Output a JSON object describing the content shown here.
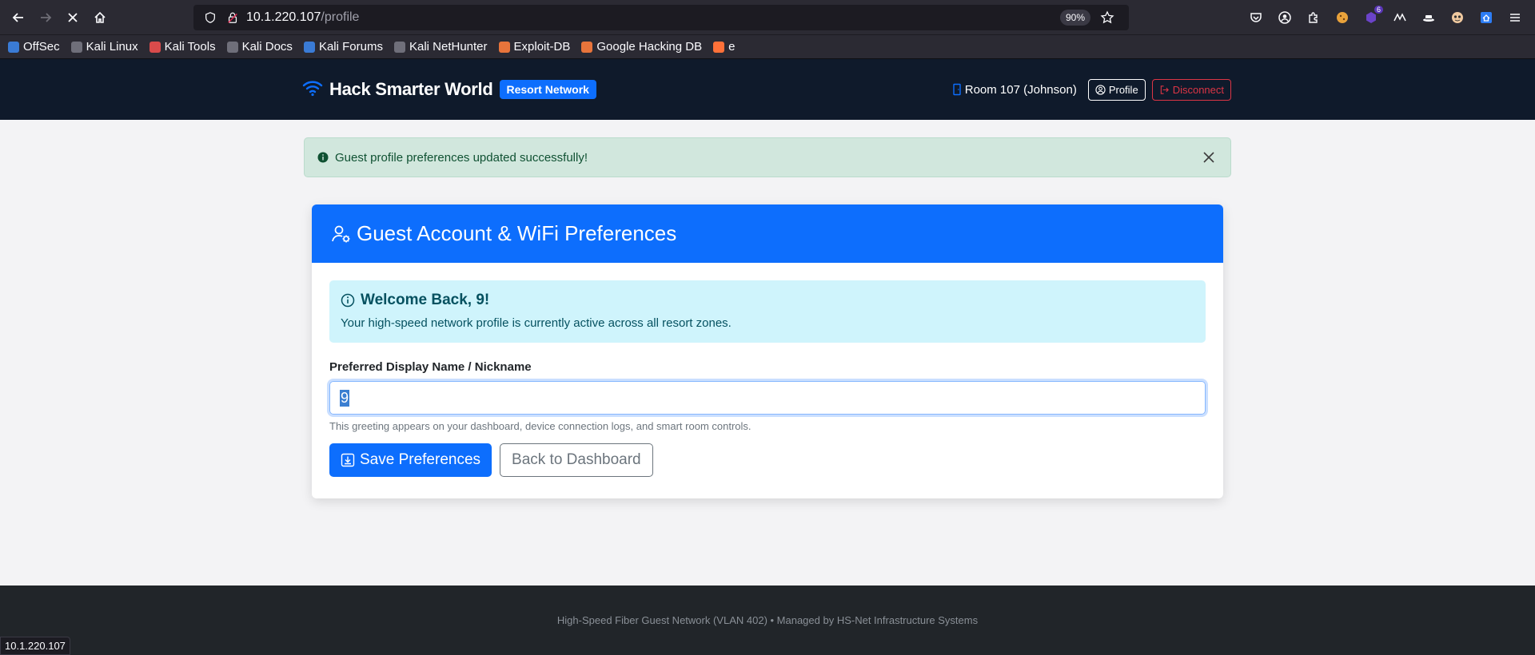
{
  "browser": {
    "url_host": "10.1.220.107",
    "url_path": "/profile",
    "zoom": "90%",
    "bookmarks": [
      {
        "label": "OffSec",
        "color": "#3a7bd5"
      },
      {
        "label": "Kali Linux",
        "color": "#6f6f7a"
      },
      {
        "label": "Kali Tools",
        "color": "#d94b4b"
      },
      {
        "label": "Kali Docs",
        "color": "#6f6f7a"
      },
      {
        "label": "Kali Forums",
        "color": "#3a7bd5"
      },
      {
        "label": "Kali NetHunter",
        "color": "#6f6f7a"
      },
      {
        "label": "Exploit-DB",
        "color": "#e8743b"
      },
      {
        "label": "Google Hacking DB",
        "color": "#e8743b"
      },
      {
        "label": "e",
        "color": "#ff7139"
      }
    ],
    "status_text": "10.1.220.107",
    "ext_badge": "6"
  },
  "site": {
    "brand_name": "Hack Smarter World",
    "brand_badge": "Resort Network",
    "room": "Room 107 (Johnson)",
    "profile_label": "Profile",
    "disconnect_label": "Disconnect"
  },
  "alert": {
    "message": "Guest profile preferences updated successfully!"
  },
  "card": {
    "title": "Guest Account & WiFi Preferences",
    "welcome_title": "Welcome Back, 9!",
    "welcome_sub": "Your high-speed network profile is currently active across all resort zones.",
    "field_label": "Preferred Display Name / Nickname",
    "field_value": "9",
    "field_help": "This greeting appears on your dashboard, device connection logs, and smart room controls.",
    "save_label": "Save Preferences",
    "back_label": "Back to Dashboard"
  },
  "footer": {
    "text": "High-Speed Fiber Guest Network (VLAN 402) • Managed by HS-Net Infrastructure Systems"
  },
  "colors": {
    "primary": "#0d6efd",
    "navbar": "#0f1a2b",
    "success_bg": "#d1e7dd",
    "info_bg": "#cff4fc",
    "danger": "#dc3545"
  }
}
